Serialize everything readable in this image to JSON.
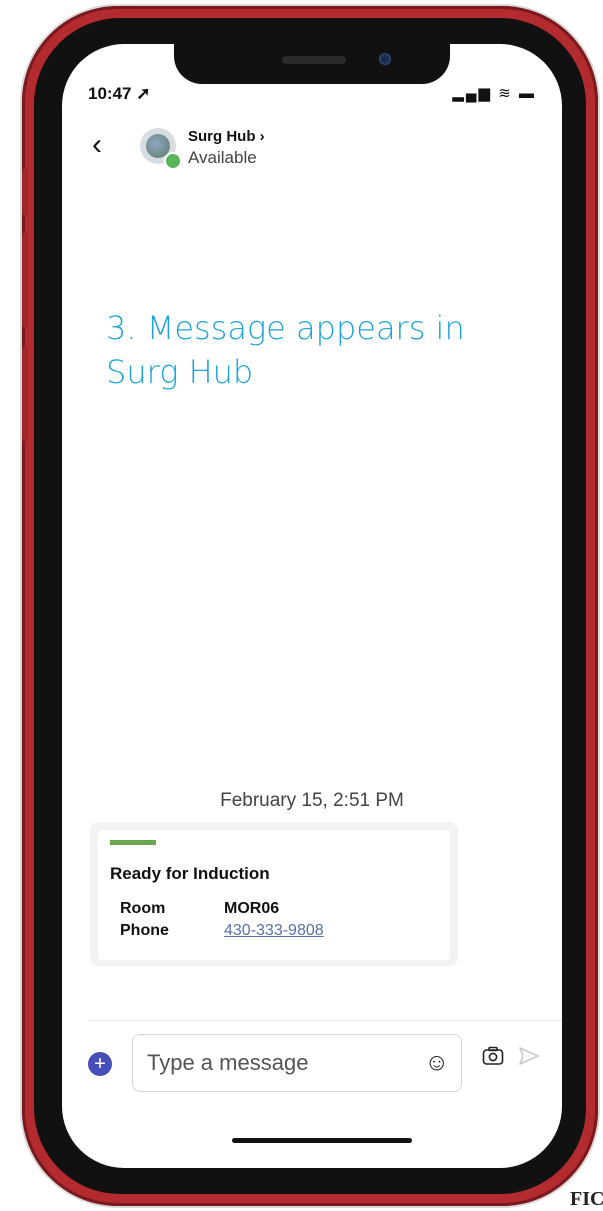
{
  "status_bar": {
    "time": "10:47 ➚",
    "icons": "▂▄▆ ≋ ▬"
  },
  "header": {
    "back_icon": "‹",
    "name": "Surg Hub ›",
    "status": "Available"
  },
  "callout": "3. Message appears in Surg Hub",
  "conversation": {
    "date": "February 15, 2:51 PM",
    "card": {
      "accent_color": "#6aa84f",
      "title": "Ready for Induction",
      "facts": [
        {
          "label": "Room",
          "value": "MOR06"
        },
        {
          "label": "Phone",
          "value": "430-333-9808"
        }
      ]
    }
  },
  "compose": {
    "plus_icon": "+",
    "placeholder": "Type a message",
    "emoji_icon": "☺",
    "camera_icon": "📷",
    "send_icon": "➢"
  },
  "corner_text": "FIC"
}
